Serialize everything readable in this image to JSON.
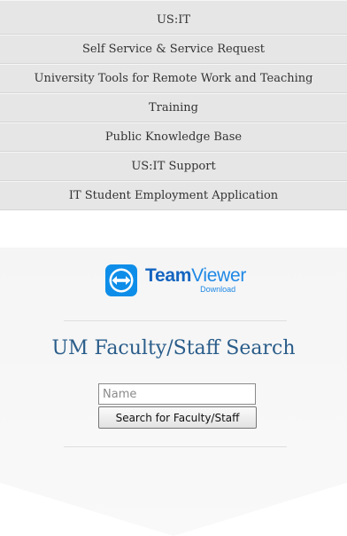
{
  "nav": {
    "items": [
      {
        "label": "US:IT"
      },
      {
        "label": "Self Service & Service Request"
      },
      {
        "label": "University Tools for Remote Work and Teaching"
      },
      {
        "label": "Training"
      },
      {
        "label": "Public Knowledge Base"
      },
      {
        "label": "US:IT Support"
      },
      {
        "label": "IT Student Employment Application"
      }
    ]
  },
  "teamviewer": {
    "brand_bold": "Team",
    "brand_light": "Viewer",
    "subtitle": "Download",
    "icon": "teamviewer-logo-icon",
    "brand_color": "#1565c0"
  },
  "search": {
    "title": "UM Faculty/Staff Search",
    "name_placeholder": "Name",
    "name_value": "",
    "button_label": "Search for Faculty/Staff",
    "title_color": "#2a5d8a"
  }
}
